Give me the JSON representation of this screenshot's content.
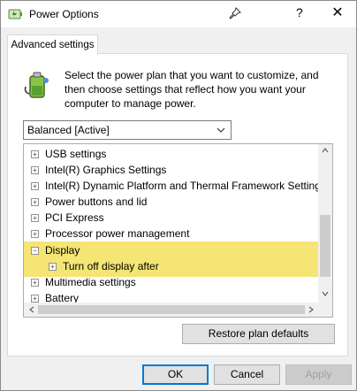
{
  "window": {
    "title": "Power Options",
    "icons": {
      "app": "power-options-icon",
      "pin": "pin-icon"
    },
    "help_label": "?",
    "close_label": "✕"
  },
  "tab": {
    "label": "Advanced settings"
  },
  "description": "Select the power plan that you want to customize, and then choose settings that reflect how you want your computer to manage power.",
  "plan_select": {
    "value": "Balanced [Active]"
  },
  "tree": {
    "items": [
      {
        "label": "USB settings",
        "expander": "+",
        "level": 0
      },
      {
        "label": "Intel(R) Graphics Settings",
        "expander": "+",
        "level": 0
      },
      {
        "label": "Intel(R) Dynamic Platform and Thermal Framework Setting",
        "expander": "+",
        "level": 0
      },
      {
        "label": "Power buttons and lid",
        "expander": "+",
        "level": 0
      },
      {
        "label": "PCI Express",
        "expander": "+",
        "level": 0
      },
      {
        "label": "Processor power management",
        "expander": "+",
        "level": 0
      },
      {
        "label": "Display",
        "expander": "−",
        "level": 0,
        "highlighted": true
      },
      {
        "label": "Turn off display after",
        "expander": "+",
        "level": 1,
        "highlighted": true
      },
      {
        "label": "Multimedia settings",
        "expander": "+",
        "level": 0
      },
      {
        "label": "Battery",
        "expander": "+",
        "level": 0
      }
    ]
  },
  "buttons": {
    "restore": "Restore plan defaults",
    "ok": "OK",
    "cancel": "Cancel",
    "apply": "Apply"
  },
  "colors": {
    "highlight": "#f2e05d",
    "accent": "#0078d7"
  }
}
